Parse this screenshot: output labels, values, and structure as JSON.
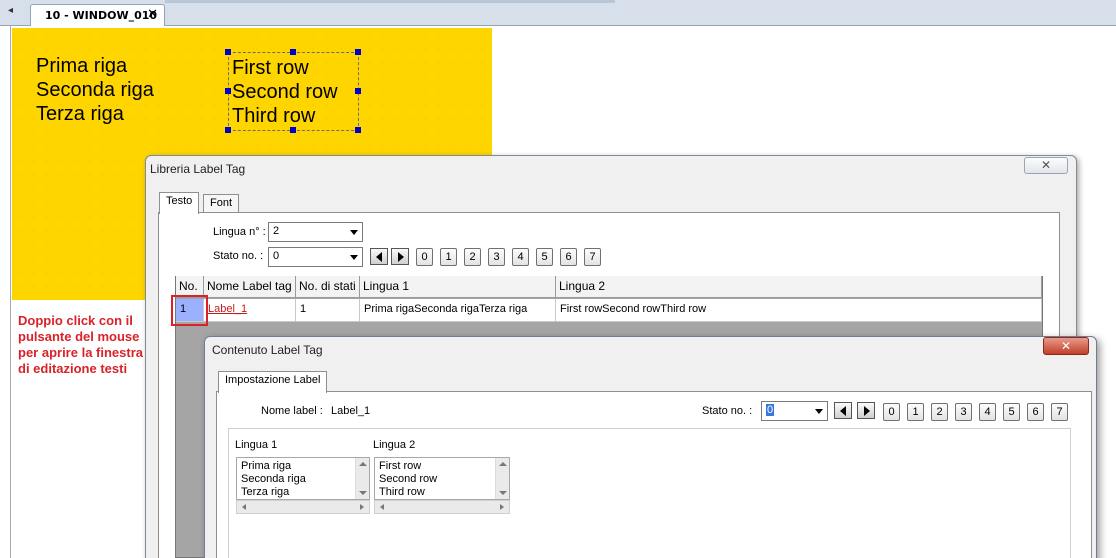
{
  "editor": {
    "tab_title": "10 - WINDOW_010",
    "tab_close": "✕",
    "nav_arrow": "◂"
  },
  "canvas": {
    "italian_lines": [
      "Prima riga",
      "Seconda riga",
      "Terza riga"
    ],
    "english_lines": [
      "First row",
      "Second row",
      "Third row"
    ],
    "instruction": "Doppio click con il pulsante del mouse per aprire la finestra di editazione testi",
    "background_color": "#ffd500"
  },
  "library_dialog": {
    "title": "Libreria Label Tag",
    "close_label": "✕",
    "tabs": [
      "Testo",
      "Font"
    ],
    "active_tab": "Testo",
    "language_label": "Lingua n° :",
    "language_value": "2",
    "state_label": "Stato no. :",
    "state_value": "0",
    "state_buttons": [
      "0",
      "1",
      "2",
      "3",
      "4",
      "5",
      "6",
      "7"
    ],
    "columns": [
      "No.",
      "Nome Label tag",
      "No. di stati",
      "Lingua 1",
      "Lingua 2"
    ],
    "rows": [
      [
        "1",
        "Label_1",
        "1",
        "Prima rigaSeconda rigaTerza riga",
        "First rowSecond rowThird row"
      ]
    ]
  },
  "content_dialog": {
    "title": "Contenuto Label Tag",
    "close_label": "✕",
    "tab": "Impostazione Label",
    "name_label": "Nome label :",
    "name_value": "Label_1",
    "state_label": "Stato no. :",
    "state_value": "0",
    "state_buttons": [
      "0",
      "1",
      "2",
      "3",
      "4",
      "5",
      "6",
      "7"
    ],
    "lang1_label": "Lingua 1",
    "lang2_label": "Lingua 2",
    "lang1_lines": [
      "Prima riga",
      "Seconda riga",
      "Terza riga"
    ],
    "lang2_lines": [
      "First row",
      "Second row",
      "Third row"
    ]
  },
  "colors": {
    "instruction_text": "#d8232a",
    "selected_cell": "#9bb0ff",
    "highlight_box": "#d9222a"
  }
}
